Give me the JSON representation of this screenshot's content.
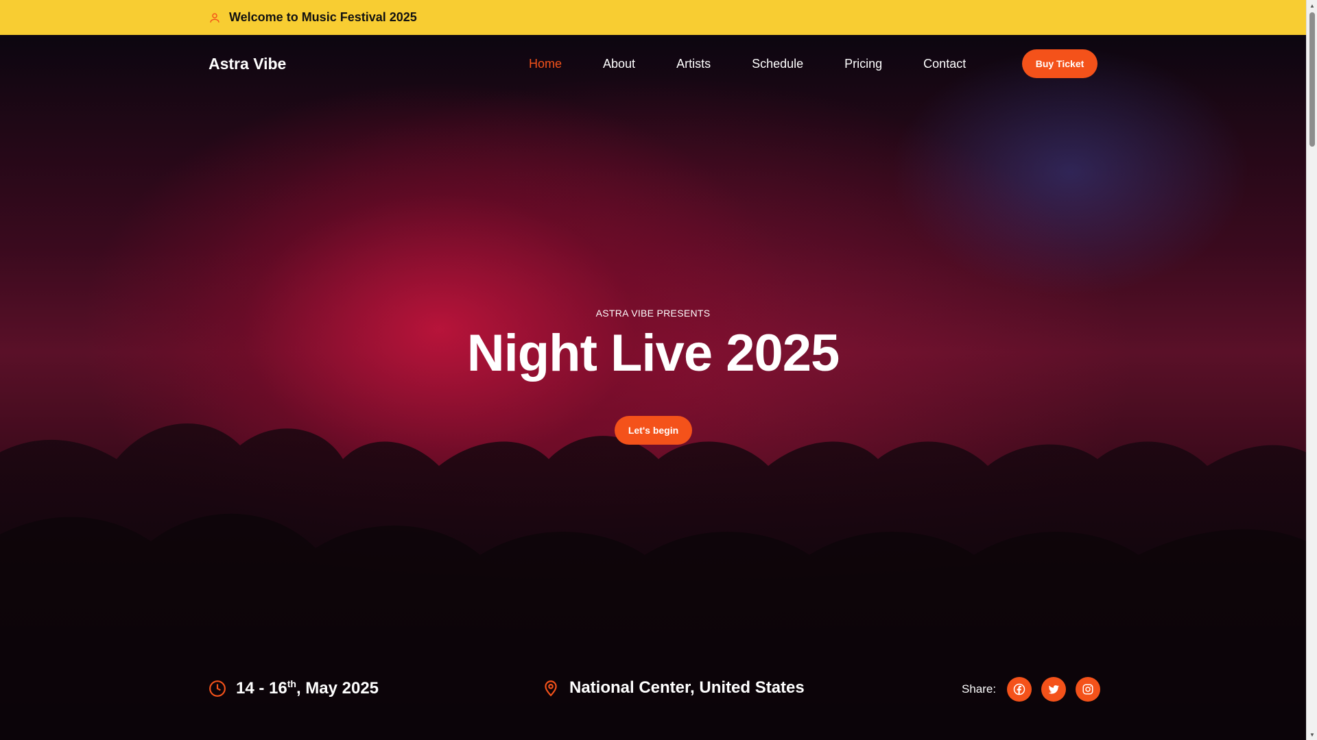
{
  "topbar": {
    "icon": "user-icon",
    "text": "Welcome to Music Festival 2025"
  },
  "nav": {
    "logo": "Astra Vibe",
    "items": [
      {
        "label": "Home",
        "active": true
      },
      {
        "label": "About"
      },
      {
        "label": "Artists"
      },
      {
        "label": "Schedule"
      },
      {
        "label": "Pricing"
      },
      {
        "label": "Contact"
      }
    ],
    "cta_label": "Buy Ticket"
  },
  "hero": {
    "presents": "ASTRA VIBE PRESENTS",
    "title": "Night Live 2025",
    "button_label": "Let's begin"
  },
  "info": {
    "date_prefix": "14 - 16",
    "date_sup": "th",
    "date_suffix": ", May 2025",
    "date_icon": "clock-icon",
    "venue": "National Center, United States",
    "venue_icon": "map-pin-icon",
    "share_label": "Share:",
    "socials": [
      "facebook-icon",
      "twitter-icon",
      "instagram-icon"
    ]
  },
  "colors": {
    "accent": "#f4521a",
    "topbar": "#f8cd32",
    "text": "#ffffff"
  }
}
